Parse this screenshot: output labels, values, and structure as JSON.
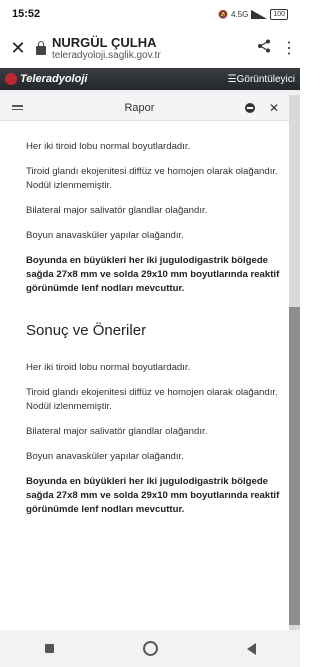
{
  "status": {
    "time": "15:52",
    "network": "4.5G",
    "battery": "100"
  },
  "browser": {
    "page_title": "NURGÜL ÇULHA",
    "url": "teleradyoloji.saglik.gov.tr"
  },
  "app": {
    "logo_text": "Teleradyoloji",
    "viewer_label": "☰Görüntüleyici"
  },
  "panel": {
    "title": "Rapor"
  },
  "report": {
    "findings": [
      "Her iki tiroid lobu normal boyutlardadır.",
      "Tiroid glandı ekojenitesi diffüz ve homojen olarak olağandır. Nodül izlenmemiştir.",
      "Bilateral major salivatör glandlar olağandır.",
      "Boyun anavasküler yapılar olağandır."
    ],
    "findings_bold": "Boyunda en büyükleri her iki jugulodigastrik bölgede sağda 27x8 mm ve solda 29x10 mm boyutlarında reaktif görünümde lenf nodları mevcuttur.",
    "conclusion_title": "Sonuç ve Öneriler",
    "conclusions": [
      "Her iki tiroid lobu normal boyutlardadır.",
      "Tiroid glandı ekojenitesi diffüz ve homojen olarak olağandır. Nodül izlenmemiştir.",
      "Bilateral major salivatör glandlar olağandır.",
      "Boyun anavasküler yapılar olağandır."
    ],
    "conclusion_bold": "Boyunda en büyükleri her iki jugulodigastrik bölgede sağda 27x8 mm ve solda 29x10 mm boyutlarında reaktif görünümde lenf nodları mevcuttur."
  }
}
